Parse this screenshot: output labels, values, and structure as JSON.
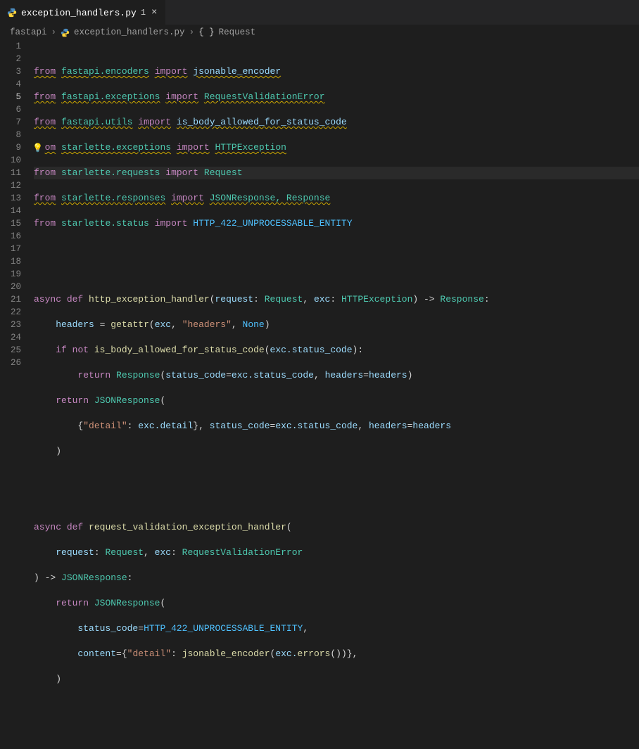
{
  "tab": {
    "filename": "exception_handlers.py",
    "modified_indicator": "1",
    "close_glyph": "×"
  },
  "breadcrumbs": {
    "items": [
      "fastapi",
      "exception_handlers.py",
      "Request"
    ],
    "brackets": "{ }"
  },
  "editor": {
    "active_line": 5,
    "line_count": 26,
    "lines": {
      "1": {
        "from": "from",
        "mod": "fastapi.encoders",
        "import": "import",
        "names": "jsonable_encoder"
      },
      "2": {
        "from": "from",
        "mod": "fastapi.exceptions",
        "import": "import",
        "names": "RequestValidationError"
      },
      "3": {
        "from": "from",
        "mod": "fastapi.utils",
        "import": "import",
        "names": "is_body_allowed_for_status_code"
      },
      "4": {
        "from_partial": "om",
        "mod": "starlette.exceptions",
        "import": "import",
        "names": "HTTPException"
      },
      "5": {
        "from": "from",
        "mod": "starlette.requests",
        "import": "import",
        "names": "Request"
      },
      "6": {
        "from": "from",
        "mod": "starlette.responses",
        "import": "import",
        "names": "JSONResponse, Response"
      },
      "7": {
        "from": "from",
        "mod": "starlette.status",
        "import": "import",
        "names": "HTTP_422_UNPROCESSABLE_ENTITY"
      },
      "10": {
        "async": "async",
        "def": "def",
        "fn": "http_exception_handler",
        "p1": "request",
        "t1": "Request",
        "p2": "exc",
        "t2": "HTTPException",
        "arrow": "->",
        "ret": "Response"
      },
      "11": {
        "lhs": "headers",
        "eq": "=",
        "call": "getattr",
        "args_a": "exc",
        "str": "\"headers\"",
        "none": "None"
      },
      "12": {
        "if": "if",
        "not": "not",
        "call": "is_body_allowed_for_status_code",
        "arg": "exc.status_code"
      },
      "13": {
        "return": "return",
        "cls": "Response",
        "k1": "status_code",
        "v1": "exc.status_code",
        "k2": "headers",
        "v2": "headers"
      },
      "14": {
        "return": "return",
        "cls": "JSONResponse"
      },
      "15": {
        "key": "\"detail\"",
        "val": "exc.detail",
        "k1": "status_code",
        "v1": "exc.status_code",
        "k2": "headers",
        "v2": "headers"
      },
      "16": {
        "close": ")"
      },
      "19": {
        "async": "async",
        "def": "def",
        "fn": "request_validation_exception_handler"
      },
      "20": {
        "p1": "request",
        "t1": "Request",
        "p2": "exc",
        "t2": "RequestValidationError"
      },
      "21": {
        "close": ")",
        "arrow": "->",
        "ret": "JSONResponse"
      },
      "22": {
        "return": "return",
        "cls": "JSONResponse"
      },
      "23": {
        "k": "status_code",
        "v": "HTTP_422_UNPROCESSABLE_ENTITY"
      },
      "24": {
        "k": "content",
        "key": "\"detail\"",
        "call": "jsonable_encoder",
        "arg": "exc.",
        "method": "errors"
      },
      "25": {
        "close": ")"
      }
    }
  }
}
